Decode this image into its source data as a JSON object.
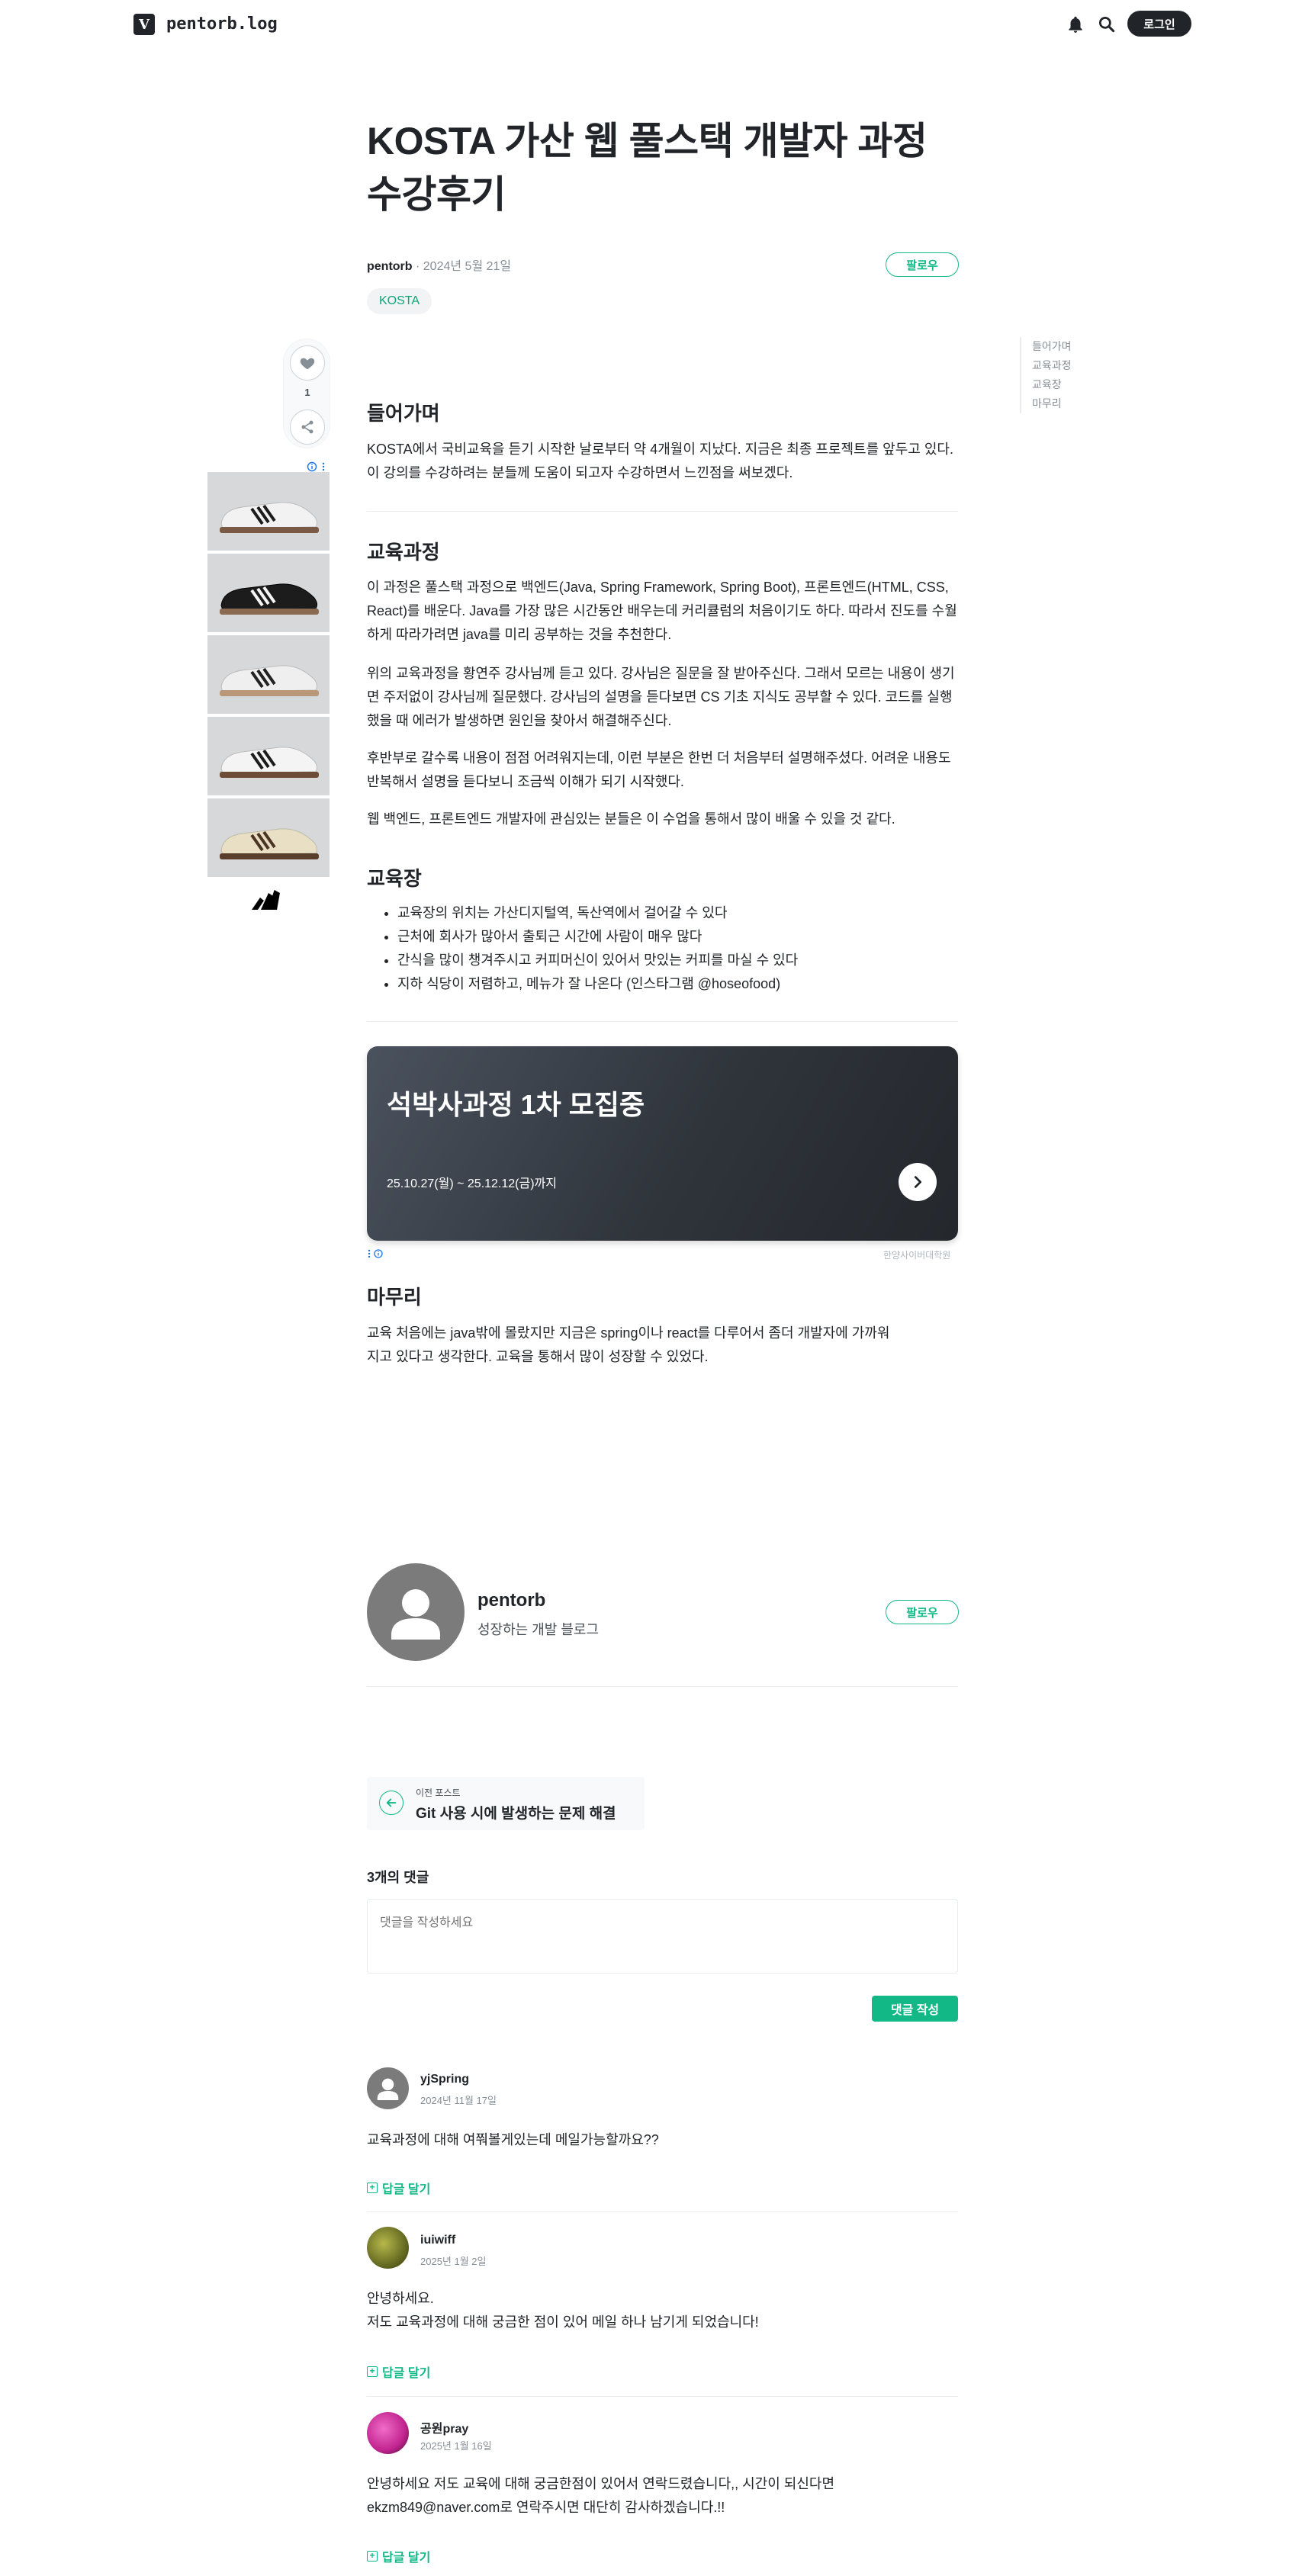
{
  "header": {
    "logo_letter": "V",
    "blog_name": "pentorb.log",
    "login_label": "로그인"
  },
  "post": {
    "title": "KOSTA 가산 웹 풀스택 개발자 과정 수강후기",
    "author": "pentorb",
    "date": "2024년 5월 21일",
    "follow_label": "팔로우",
    "tag": "KOSTA",
    "like_count": "1"
  },
  "toc": [
    "들어가며",
    "교육과정",
    "교육장",
    "마무리"
  ],
  "sections": {
    "intro_title": "들어가며",
    "intro_p1": "KOSTA에서 국비교육을 듣기 시작한 날로부터 약 4개월이 지났다. 지금은 최종 프로젝트를 앞두고 있다. 이 강의를 수강하려는 분들께 도움이 되고자 수강하면서 느낀점을 써보겠다.",
    "course_title": "교육과정",
    "course_p1": "이 과정은 풀스택 과정으로 백엔드(Java, Spring Framework, Spring Boot), 프론트엔드(HTML, CSS, React)를 배운다. Java를 가장 많은 시간동안 배우는데 커리큘럼의 처음이기도 하다. 따라서 진도를 수월하게 따라가려면 java를 미리 공부하는 것을 추천한다.",
    "course_p2": "위의 교육과정을 황연주 강사님께 듣고 있다. 강사님은 질문을 잘 받아주신다. 그래서 모르는 내용이 생기면 주저없이 강사님께 질문했다. 강사님의 설명을 듣다보면 CS 기초 지식도 공부할 수 있다. 코드를 실행했을 때 에러가 발생하면 원인을 찾아서 해결해주신다.",
    "course_p3": "후반부로 갈수록 내용이 점점 어려워지는데, 이런 부분은 한번 더 처음부터 설명해주셨다. 어려운 내용도 반복해서 설명을 듣다보니 조금씩 이해가 되기 시작했다.",
    "course_p4": "웹 백엔드, 프론트엔드 개발자에 관심있는 분들은 이 수업을 통해서 많이 배울 수 있을 것 같다.",
    "place_title": "교육장",
    "place_items": [
      "교육장의 위치는 가산디지털역, 독산역에서 걸어갈 수 있다",
      "근처에 회사가 많아서 출퇴근 시간에 사람이 매우 많다",
      "간식을 많이 챙겨주시고 커피머신이 있어서 맛있는 커피를 마실 수 있다",
      "지하 식당이 저렴하고, 메뉴가 잘 나온다 (인스타그램 @hoseofood)"
    ],
    "outro_title": "마무리",
    "outro_p1": "교육 처음에는 java밖에 몰랐지만 지금은 spring이나 react를 다루어서 좀더 개발자에 가까워지고 있다고 생각한다. 교육을 통해서 많이 성장할 수 있었다."
  },
  "banner": {
    "title": "석박사과정 1차 모집중",
    "subtitle": "25.10.27(월) ~ 25.12.12(금)까지",
    "source": "한양사이버대학원"
  },
  "profile": {
    "name": "pentorb",
    "description": "성장하는 개발 블로그",
    "follow_label": "팔로우"
  },
  "prev_post": {
    "label": "이전 포스트",
    "title": "Git 사용 시에 발생하는 문제 해결"
  },
  "comments": {
    "count_label": "3개의 댓글",
    "placeholder": "댓글을 작성하세요",
    "submit_label": "댓글 작성",
    "reply_label": "답글 달기",
    "items": [
      {
        "user": "yjSpring",
        "date": "2024년 11월 17일",
        "text": "교육과정에 대해 여쭤볼게있는데 메일가능할까요??"
      },
      {
        "user": "iuiwiff",
        "date": "2025년 1월 2일",
        "text_line1": "안녕하세요.",
        "text_line2": "저도 교육과정에 대해 궁금한 점이 있어 메일 하나 남기게 되었습니다!"
      },
      {
        "user": "공원pray",
        "date": "2025년 1월 16일",
        "text_line1": "안녕하세요 저도 교육에 대해 궁금한점이 있어서 연락드렸습니다,, 시간이 되신다면",
        "text_line2": "ekzm849@naver.com로 연락주시면 대단히 감사하겠습니다.!!"
      }
    ]
  },
  "colors": {
    "accent": "#12b886",
    "text": "#212529",
    "muted": "#868e96"
  }
}
